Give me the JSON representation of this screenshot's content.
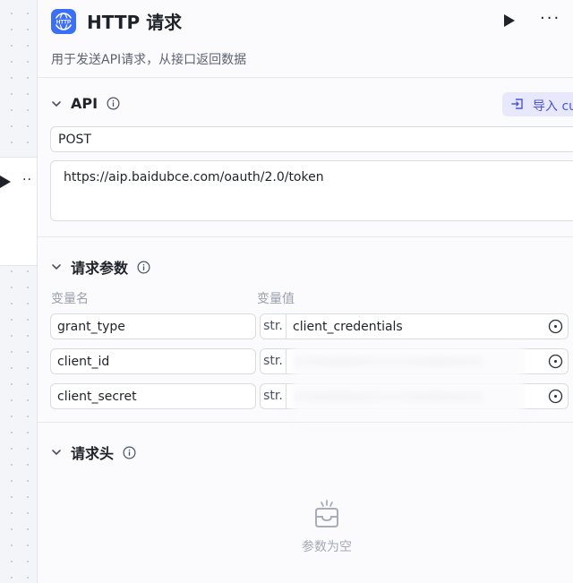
{
  "node": {
    "title": "HTTP 请求",
    "description": "用于发送API请求，从接口返回数据",
    "logo_text": "HTTP",
    "logo_color": "#3b6ff5"
  },
  "header": {
    "run_icon": "play-icon",
    "more_icon": "more-icon"
  },
  "api_section": {
    "title": "API",
    "import_label": "导入 cu",
    "method": "POST",
    "url": "https://aip.baidubce.com/oauth/2.0/token"
  },
  "params_section": {
    "title": "请求参数",
    "col_name": "变量名",
    "col_value": "变量值",
    "rows": [
      {
        "name": "grant_type",
        "type": "str.",
        "value": "client_credentials"
      },
      {
        "name": "client_id",
        "type": "str.",
        "value": ""
      },
      {
        "name": "client_secret",
        "type": "str.",
        "value": ""
      }
    ]
  },
  "headers_section": {
    "title": "请求头",
    "empty_text": "参数为空"
  },
  "colors": {
    "accent": "#4c54d6",
    "import_bg": "#e7e8fb"
  }
}
